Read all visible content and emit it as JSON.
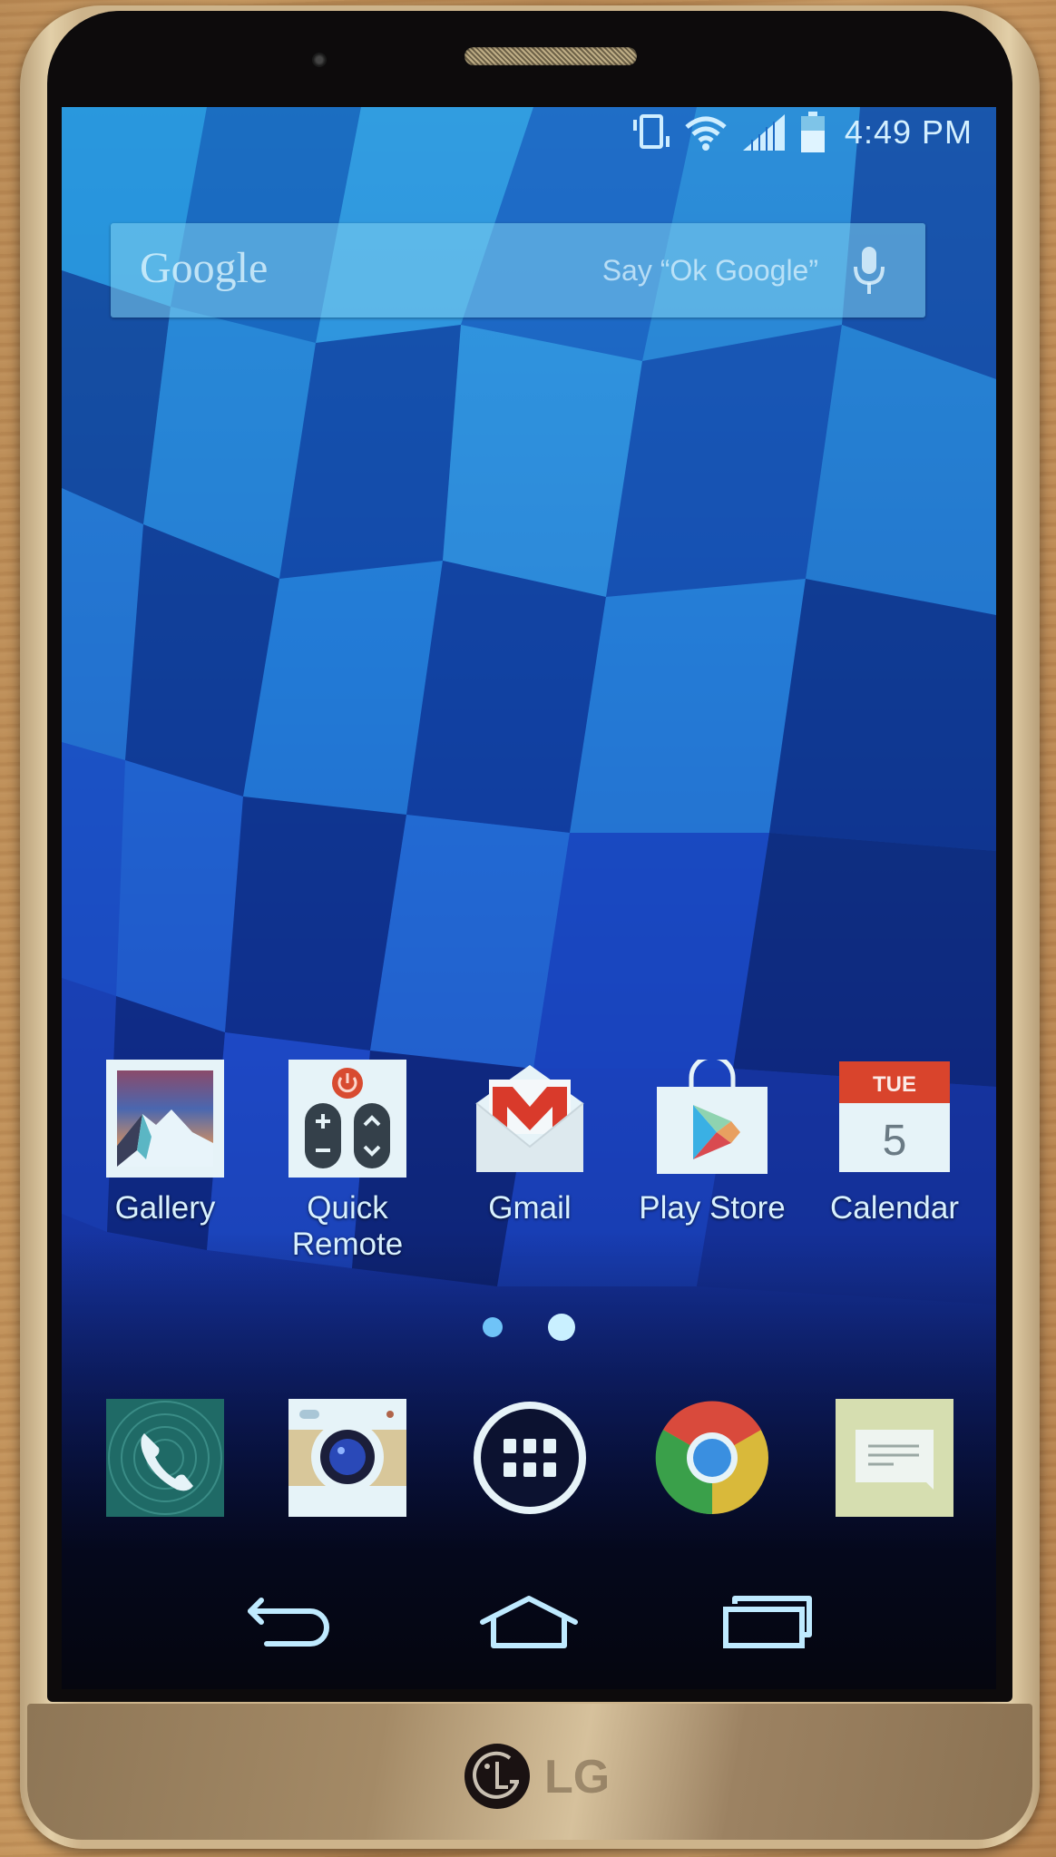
{
  "device": {
    "brand_logo": "LG"
  },
  "status_bar": {
    "icons": [
      "vibrate-icon",
      "wifi-icon",
      "signal-icon",
      "battery-icon"
    ],
    "battery_level_percent": 60,
    "time": "4:49 PM"
  },
  "search_widget": {
    "logo_text": "Google",
    "hint": "Say “Ok Google”",
    "icon": "mic-icon"
  },
  "home_apps": [
    {
      "label": "Gallery",
      "icon": "gallery-icon"
    },
    {
      "label": "Quick Remote",
      "icon": "quick-remote-icon"
    },
    {
      "label": "Gmail",
      "icon": "gmail-icon"
    },
    {
      "label": "Play Store",
      "icon": "play-store-icon"
    },
    {
      "label": "Calendar",
      "icon": "calendar-icon",
      "day": "TUE",
      "date": "5"
    }
  ],
  "page_indicator": {
    "total": 2,
    "current": 2
  },
  "dock_apps": [
    {
      "name": "Phone",
      "icon": "phone-icon"
    },
    {
      "name": "Camera",
      "icon": "camera-icon"
    },
    {
      "name": "Apps",
      "icon": "app-drawer-icon"
    },
    {
      "name": "Chrome",
      "icon": "chrome-icon"
    },
    {
      "name": "Messaging",
      "icon": "messaging-icon"
    }
  ],
  "nav_bar": {
    "buttons": [
      "back",
      "home",
      "recent-apps"
    ]
  },
  "colors": {
    "ui_text": "#d8f1ff",
    "calendar_header": "#d9442c",
    "gmail_red": "#d93a2b"
  }
}
